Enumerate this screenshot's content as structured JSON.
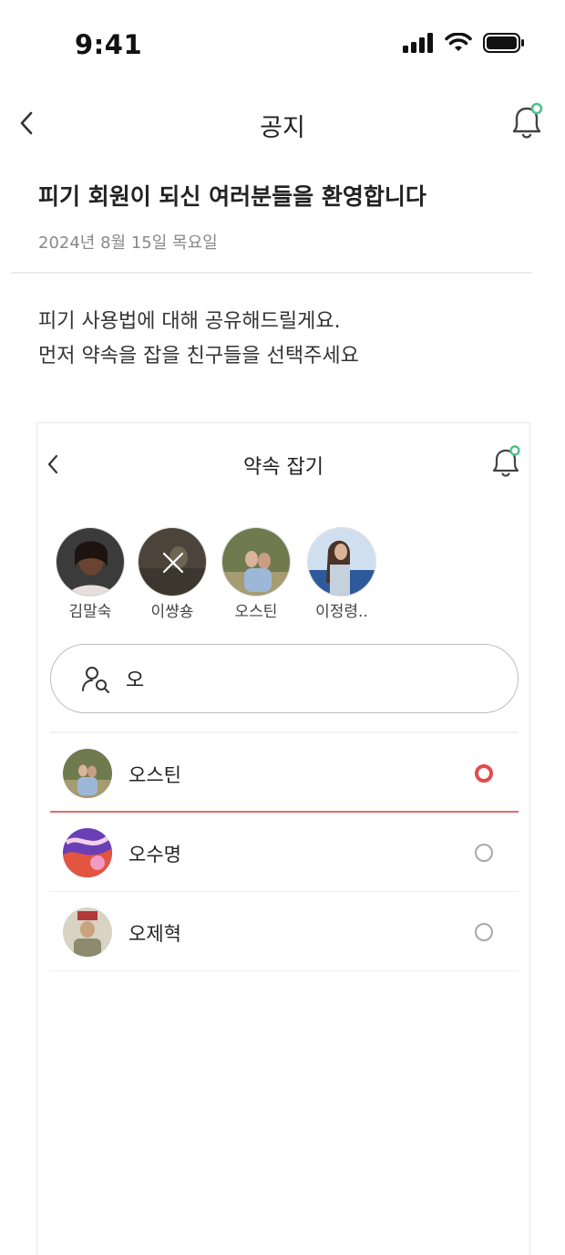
{
  "status_bar": {
    "time": "9:41",
    "icons": [
      "signal-icon",
      "wifi-icon",
      "battery-icon"
    ]
  },
  "nav": {
    "title": "공지",
    "back_icon": "chevron-left-icon",
    "bell_icon": "bell-icon",
    "notification_dot_color": "#4cc38a"
  },
  "notice": {
    "title": "피기 회원이 되신 여러분들을 환영합니다",
    "date": "2024년 8월 15일 목요일",
    "body_lines": [
      "피기 사용법에 대해 공유해드릴게요.",
      "먼저 약속을 잡을 친구들을 선택주세요"
    ]
  },
  "embedded_screen": {
    "title": "약속 잡기",
    "selected_friends": [
      {
        "name": "김말숙",
        "removing": false
      },
      {
        "name": "이썅숑",
        "removing": true
      },
      {
        "name": "오스틴",
        "removing": false
      },
      {
        "name": "이정령..",
        "removing": false
      }
    ],
    "search": {
      "value": "오",
      "icon": "person-search-icon"
    },
    "results": [
      {
        "name": "오스틴",
        "selected": true
      },
      {
        "name": "오수명",
        "selected": false
      },
      {
        "name": "오제혁",
        "selected": false
      }
    ]
  },
  "colors": {
    "accent_red": "#e34b4b",
    "notification_green": "#4cc38a",
    "divider": "#ececec"
  }
}
